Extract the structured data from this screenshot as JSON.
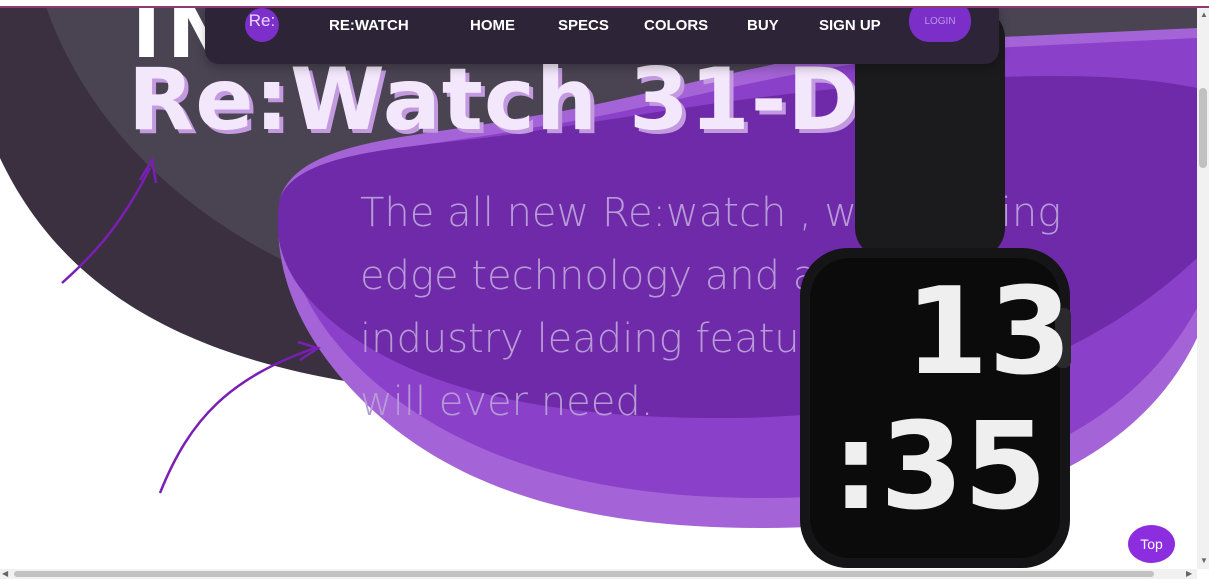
{
  "hero": {
    "title_top": "IN",
    "title": "Re:Watch 31-D",
    "description": "The all new Re:watch , with cutting edge technology and all new industry leading feature that you will ever need."
  },
  "nav": {
    "logo": "Re:",
    "items": [
      "RE:WATCH",
      "HOME",
      "SPECS",
      "COLORS",
      "BUY",
      "SIGN UP"
    ],
    "login": "LOGIN"
  },
  "watch": {
    "hour": "13",
    "minute": ":35"
  },
  "top_button": "Top",
  "colors": {
    "accent": "#8d2de0",
    "nav_bg": "#2d2437",
    "dark_blob": "#3a3040",
    "purple_blob": "#7b32c2"
  },
  "icons": [
    "arrow-annotation",
    "scroll-arrow-up",
    "scroll-arrow-down",
    "scroll-arrow-left",
    "scroll-arrow-right"
  ]
}
